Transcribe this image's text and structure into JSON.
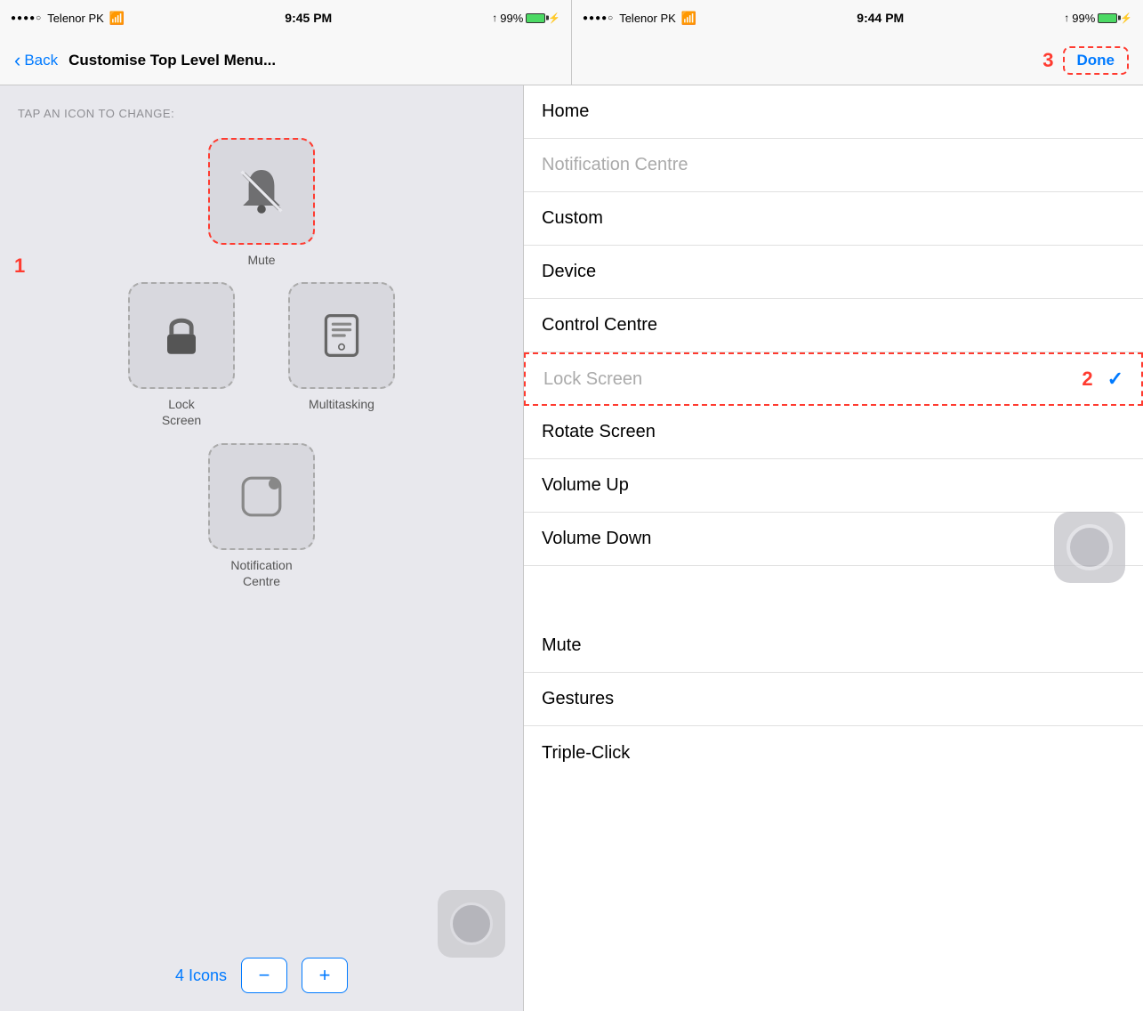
{
  "left_status": {
    "dots": "●●●●○",
    "carrier": "Telenor PK",
    "wifi": "WiFi",
    "time": "9:45 PM",
    "arrow": "↑",
    "battery_pct": "99%",
    "bolt": "⚡"
  },
  "right_status": {
    "dots": "●●●●○",
    "carrier": "Telenor PK",
    "wifi": "WiFi",
    "time": "9:44 PM",
    "arrow": "↑",
    "battery_pct": "99%",
    "bolt": "⚡"
  },
  "nav_left": {
    "back_label": "Back",
    "title": "Customise Top Level Menu...",
    "step1": "1"
  },
  "nav_right": {
    "step3": "3",
    "done_label": "Done"
  },
  "left_panel": {
    "tap_label": "TAP AN ICON TO CHANGE:",
    "step1_badge": "1",
    "icons": [
      {
        "name": "Mute",
        "selected": true,
        "icon": "mute"
      },
      {
        "name": "Lock\nScreen",
        "selected": false,
        "icon": "lock"
      },
      {
        "name": "Multitasking",
        "selected": false,
        "icon": "multitasking"
      },
      {
        "name": "Notification\nCentre",
        "selected": false,
        "icon": "notification"
      }
    ],
    "icons_count": "4 Icons",
    "minus_label": "−",
    "plus_label": "+"
  },
  "right_panel": {
    "step2_badge": "2",
    "items": [
      {
        "label": "Home",
        "greyed": false,
        "selected": false,
        "check": false
      },
      {
        "label": "Notification Centre",
        "greyed": true,
        "selected": false,
        "check": false
      },
      {
        "label": "Custom",
        "greyed": false,
        "selected": false,
        "check": false
      },
      {
        "label": "Device",
        "greyed": false,
        "selected": false,
        "check": false
      },
      {
        "label": "Control Centre",
        "greyed": false,
        "selected": false,
        "check": false
      },
      {
        "label": "Lock Screen",
        "greyed": false,
        "selected": true,
        "check": true
      },
      {
        "label": "Rotate Screen",
        "greyed": false,
        "selected": false,
        "check": false
      },
      {
        "label": "Volume Up",
        "greyed": false,
        "selected": false,
        "check": false
      },
      {
        "label": "Volume Down",
        "greyed": false,
        "selected": false,
        "check": false
      },
      {
        "label": "Mute",
        "greyed": false,
        "selected": false,
        "check": false
      },
      {
        "label": "Gestures",
        "greyed": false,
        "selected": false,
        "check": false
      },
      {
        "label": "Triple-Click",
        "greyed": false,
        "selected": false,
        "check": false
      }
    ]
  }
}
